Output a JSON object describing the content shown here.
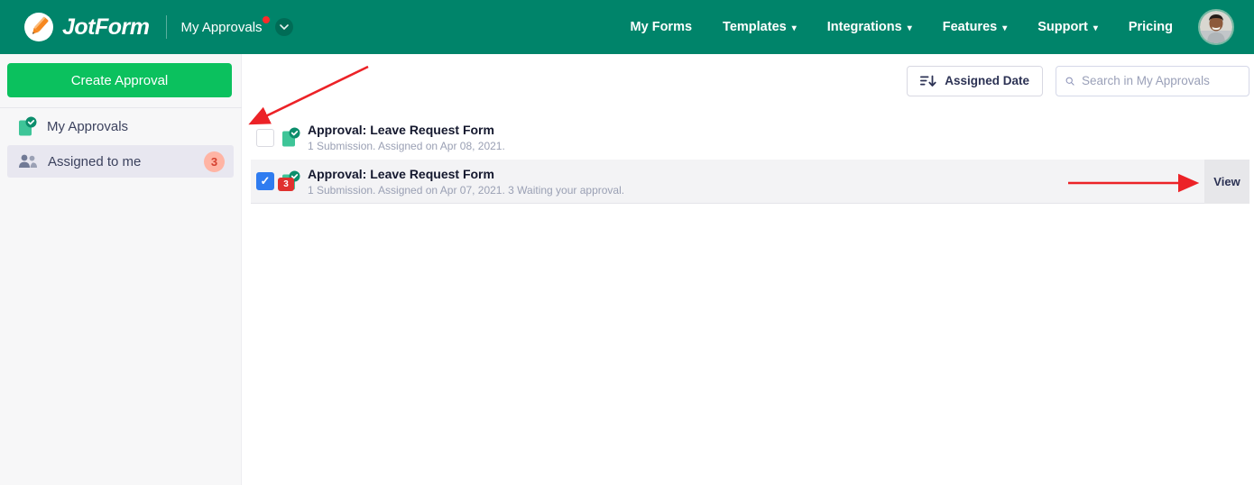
{
  "navbar": {
    "brand": "JotForm",
    "workspace": {
      "label": "My Approvals",
      "has_notification_dot": true
    },
    "caret_glyph": "▾",
    "links": [
      {
        "label": "My Forms",
        "caret": false
      },
      {
        "label": "Templates",
        "caret": true
      },
      {
        "label": "Integrations",
        "caret": true
      },
      {
        "label": "Features",
        "caret": true
      },
      {
        "label": "Support",
        "caret": true
      },
      {
        "label": "Pricing",
        "caret": false
      }
    ]
  },
  "sidebar": {
    "create_button_label": "Create Approval",
    "items": [
      {
        "label": "My Approvals",
        "badge": "",
        "selected": false
      },
      {
        "label": "Assigned to me",
        "badge": "3",
        "selected": true
      }
    ]
  },
  "toolbar": {
    "sort_label": "Assigned Date",
    "search_placeholder": "Search in My Approvals"
  },
  "list": {
    "rows": [
      {
        "title": "Approval: Leave Request Form",
        "subtitle": "1 Submission. Assigned on Apr 08, 2021.",
        "checked": false,
        "badge": "",
        "action": ""
      },
      {
        "title": "Approval: Leave Request Form",
        "subtitle": "1 Submission. Assigned on Apr 07, 2021. 3 Waiting your approval.",
        "checked": true,
        "badge": "3",
        "action": "View"
      }
    ],
    "checkmark_glyph": "✓"
  },
  "colors": {
    "navbar_green": "#00846A",
    "create_button_green": "#0BC15E",
    "checkbox_blue": "#2f7cf0",
    "badge_red": "#E0312E",
    "sidebar_badge_bg": "#FFB4A4",
    "sidebar_badge_text": "#D5402F",
    "selected_row_bg": "#f3f3f5",
    "arrow_red": "#EC2227"
  }
}
